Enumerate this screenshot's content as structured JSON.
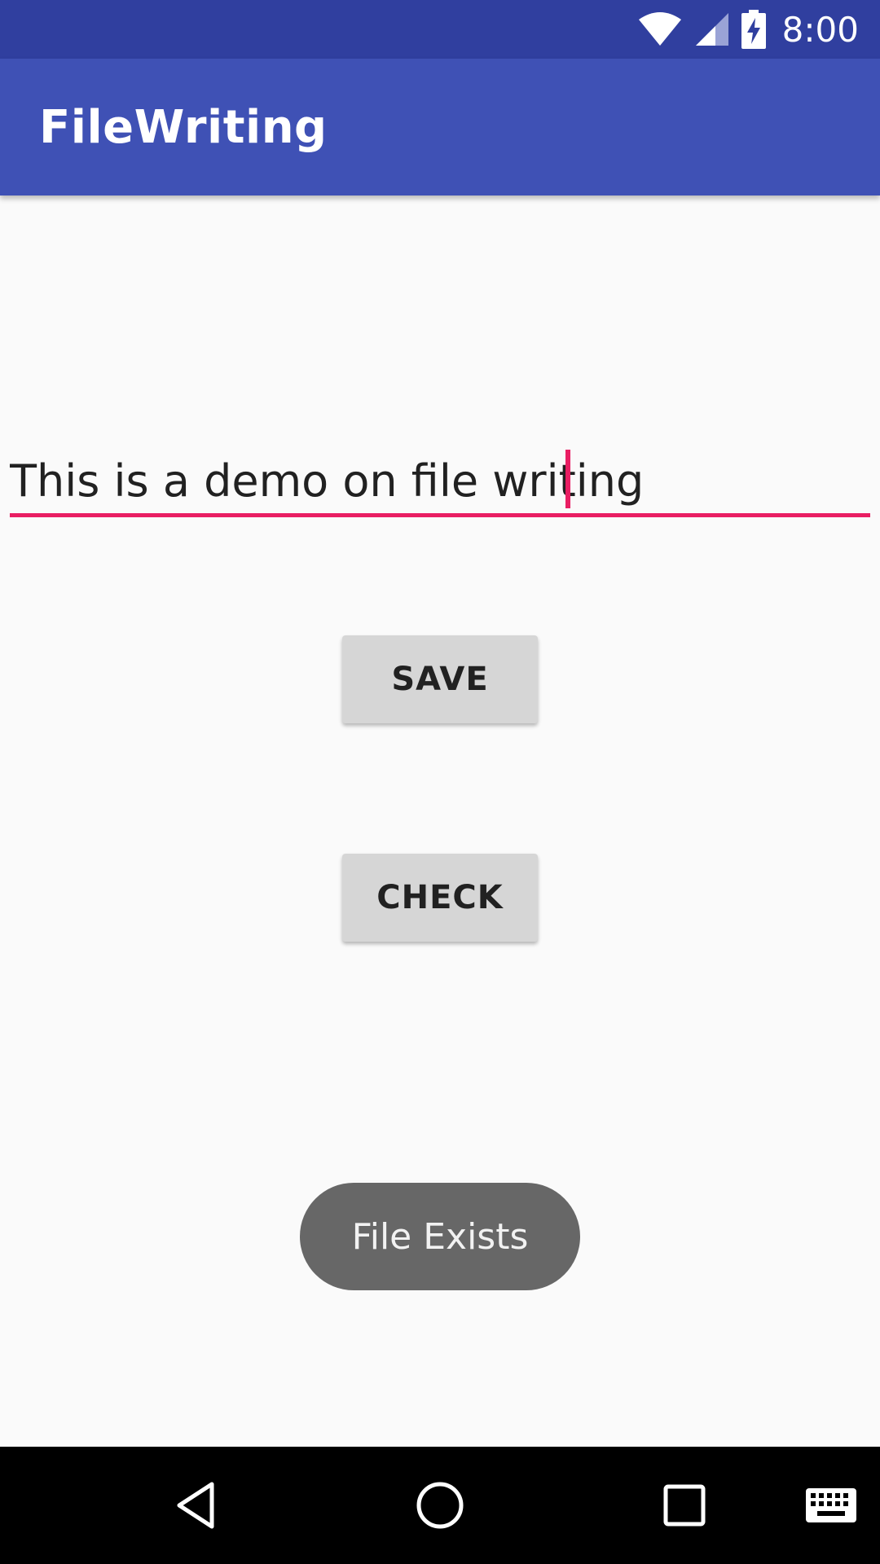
{
  "status_bar": {
    "time": "8:00",
    "icons": [
      "wifi-icon",
      "signal-icon",
      "battery-charging-icon"
    ]
  },
  "app_bar": {
    "title": "FileWriting",
    "color": "#3f51b5",
    "status_color": "#303f9f"
  },
  "form": {
    "text_value": "This is a demo on file writing",
    "accent_color": "#e91e63"
  },
  "buttons": {
    "save_label": "SAVE",
    "check_label": "CHECK"
  },
  "toast": {
    "message": "File Exists"
  },
  "nav_bar": {
    "icons": [
      "back-icon",
      "home-icon",
      "recents-icon",
      "keyboard-icon"
    ]
  }
}
